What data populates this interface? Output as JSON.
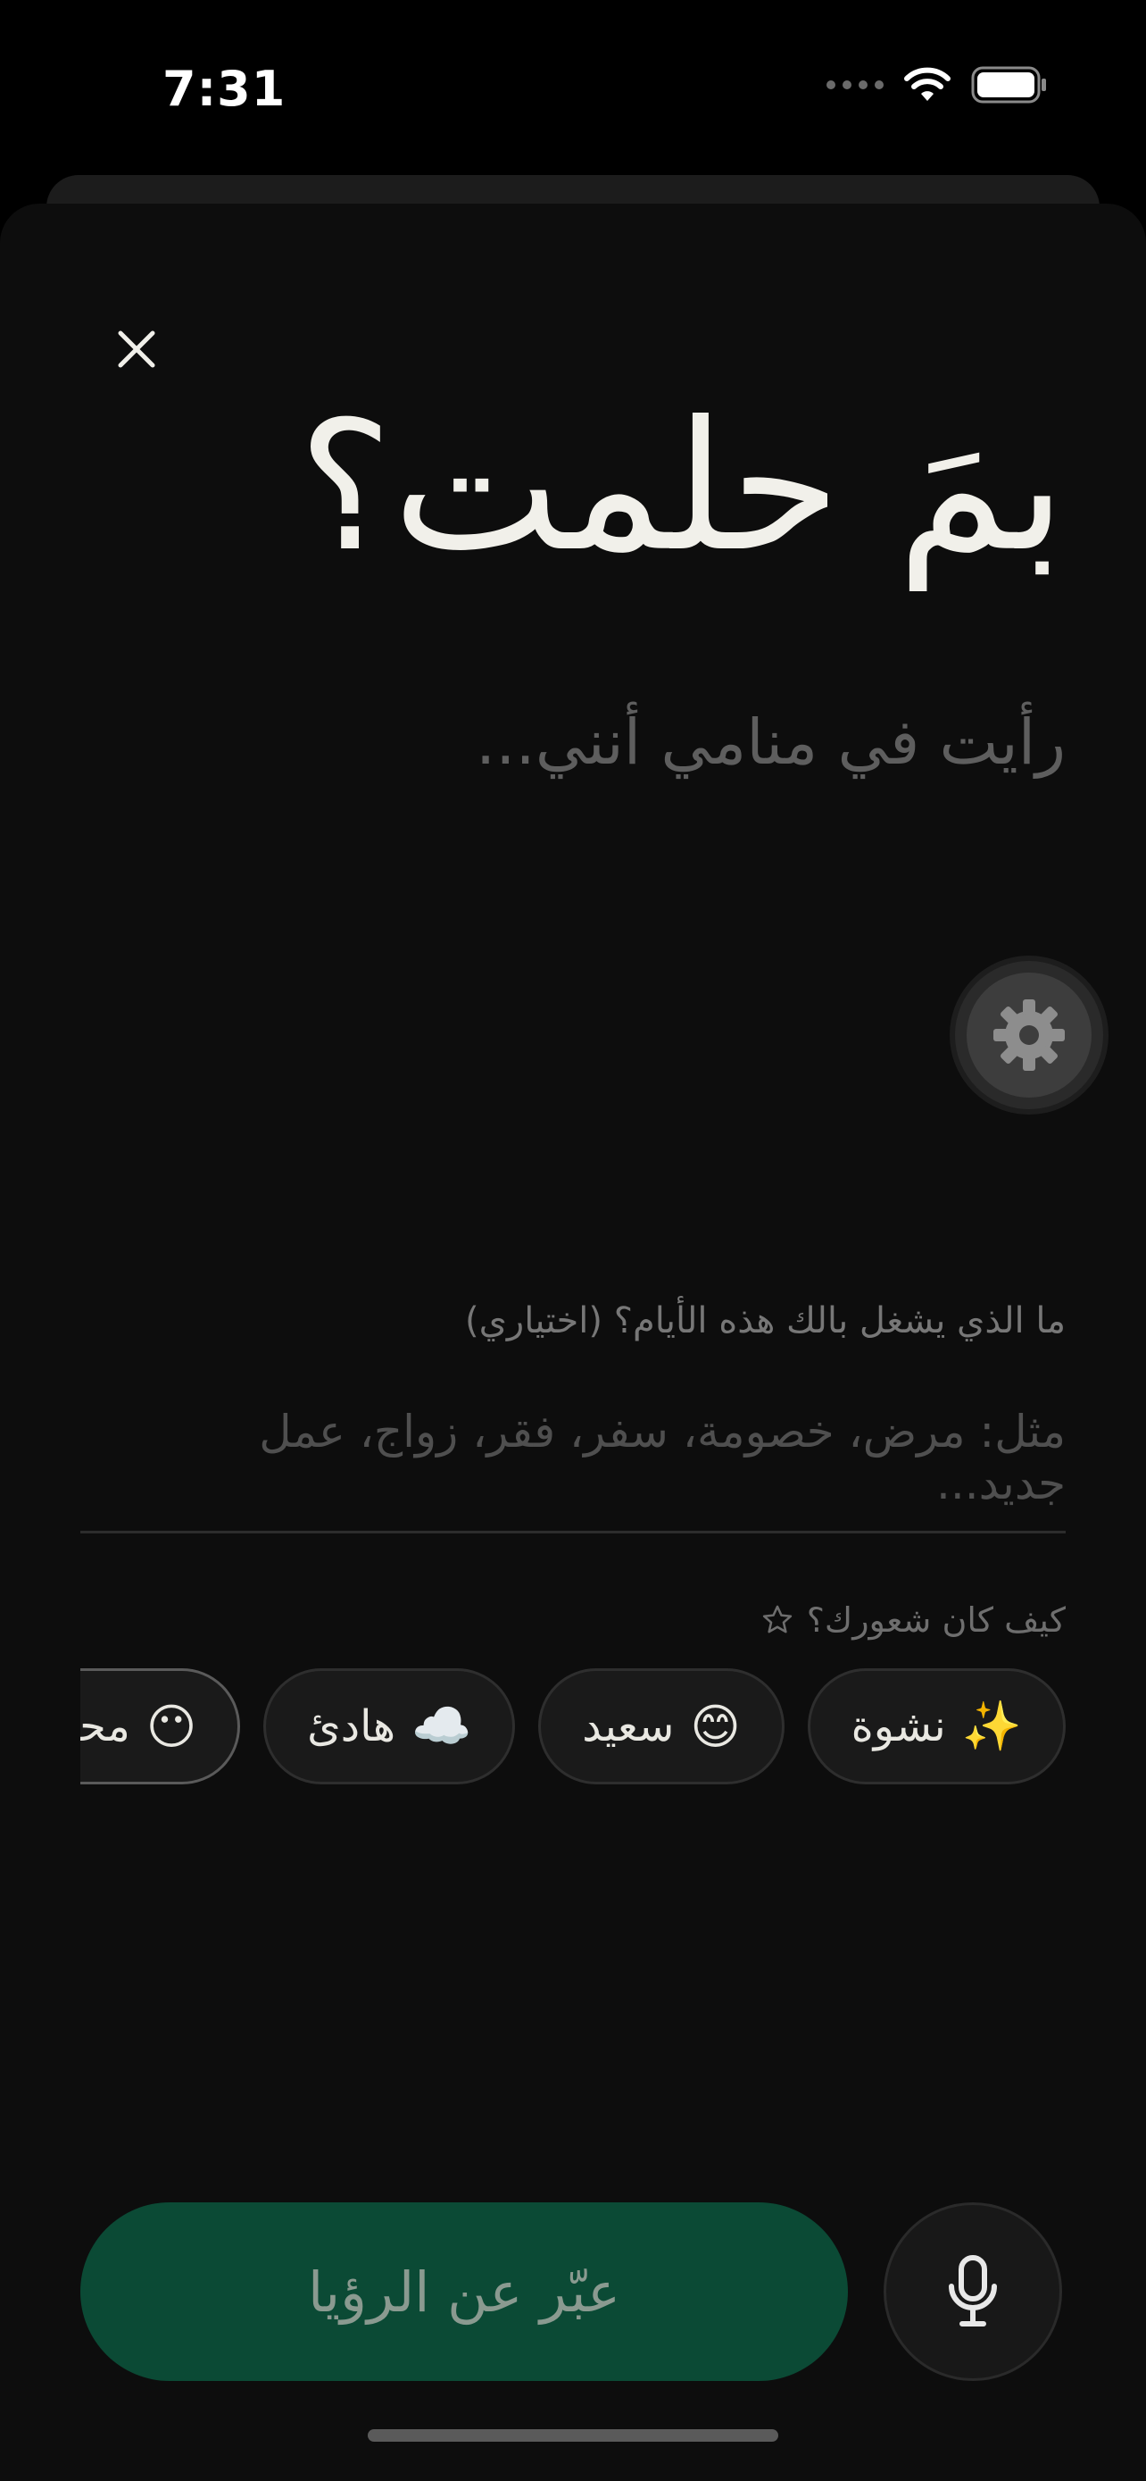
{
  "status_bar": {
    "time": "7:31"
  },
  "sheet": {
    "title": "بمَ حلمت؟",
    "dream_placeholder": "رأيت في منامي أنني...",
    "context_label": "ما الذي يشغل بالك هذه الأيام؟ (اختياري)",
    "context_placeholder": "مثل: مرض، خصومة، سفر، فقر، زواج، عمل جديد...",
    "mood_label": "كيف كان شعورك؟",
    "moods": [
      {
        "emoji": "✨",
        "label": "نشوة"
      },
      {
        "emoji": "😊",
        "label": "سعيد"
      },
      {
        "emoji": "☁️",
        "label": "هادئ"
      },
      {
        "emoji": "😶",
        "label": "محايد"
      }
    ],
    "primary_button": "عبّر عن الرؤيا"
  },
  "colors": {
    "accent": "#0b4a35",
    "background": "#0d0d0d",
    "text": "#f1f0ea"
  },
  "icons": [
    "close-icon",
    "gear-icon",
    "star-icon",
    "mic-icon",
    "wifi-icon",
    "battery-icon"
  ]
}
